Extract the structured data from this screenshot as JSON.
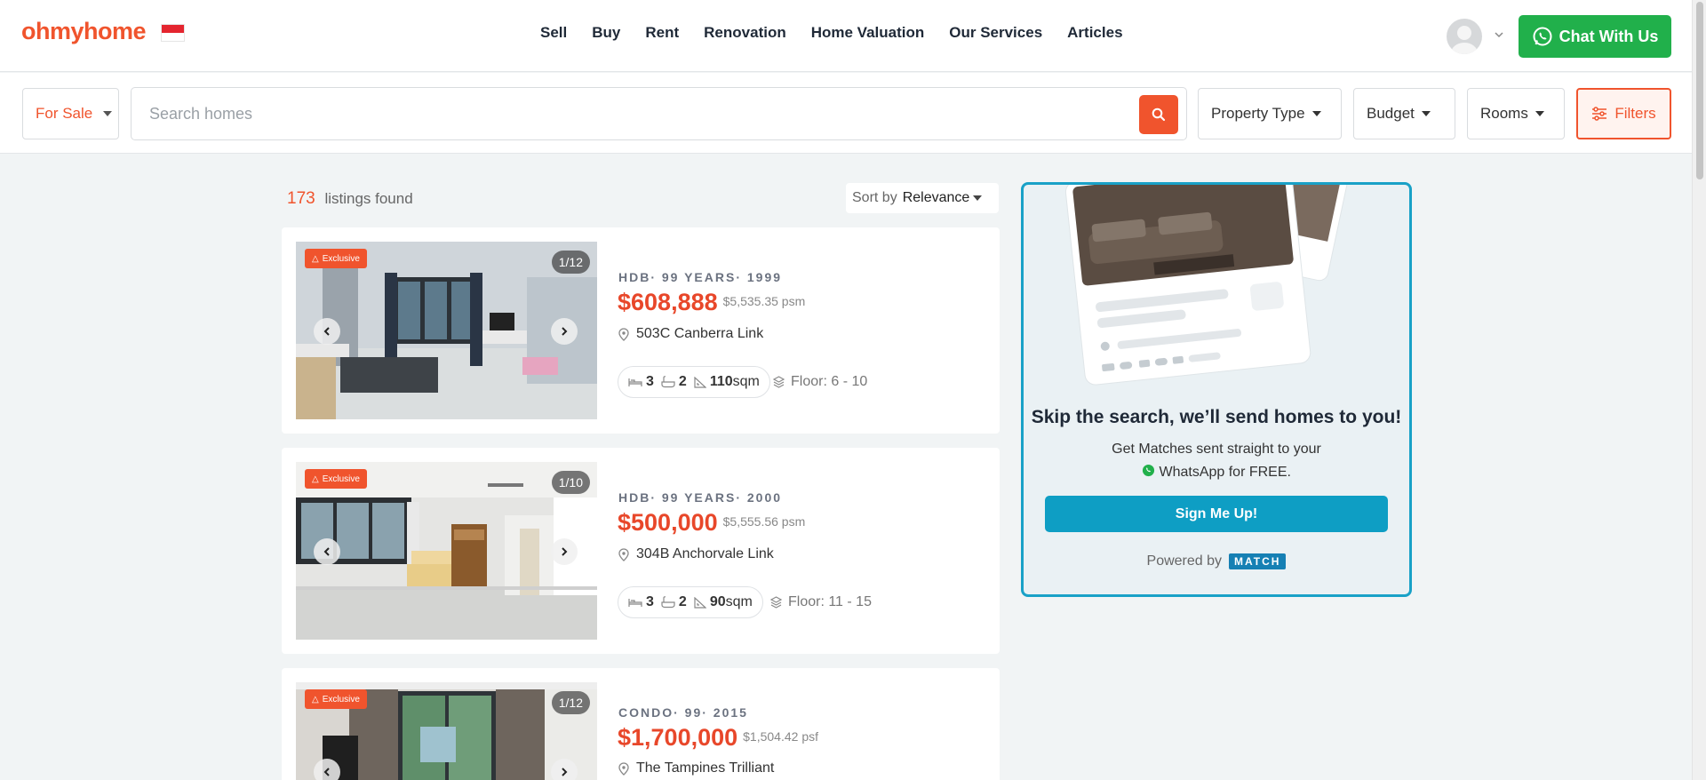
{
  "header": {
    "logo": "ohmyhome",
    "nav": [
      "Sell",
      "Buy",
      "Rent",
      "Renovation",
      "Home Valuation",
      "Our Services",
      "Articles"
    ],
    "chat_label": "Chat With Us"
  },
  "search": {
    "mode": "For Sale",
    "placeholder": "Search homes",
    "property_type": "Property Type",
    "budget": "Budget",
    "rooms": "Rooms",
    "filters": "Filters"
  },
  "results": {
    "count": "173",
    "count_label": "listings found",
    "sort_label": "Sort by",
    "sort_value": "Relevance"
  },
  "listings": [
    {
      "badge": "Exclusive",
      "counter": "1/12",
      "type": "HDB· 99 YEARS· 1999",
      "price": "$608,888",
      "psm": "$5,535.35 psm",
      "address": "503C Canberra Link",
      "beds": "3",
      "baths": "2",
      "area_value": "110",
      "area_unit": "sqm",
      "floor": "Floor: 6 - 10"
    },
    {
      "badge": "Exclusive",
      "counter": "1/10",
      "type": "HDB· 99 YEARS· 2000",
      "price": "$500,000",
      "psm": "$5,555.56 psm",
      "address": "304B Anchorvale Link",
      "beds": "3",
      "baths": "2",
      "area_value": "90",
      "area_unit": "sqm",
      "floor": "Floor: 11 - 15"
    },
    {
      "badge": "Exclusive",
      "counter": "1/12",
      "type": "CONDO· 99· 2015",
      "price": "$1,700,000",
      "psm": "$1,504.42 psf",
      "address": "The Tampines Trilliant"
    }
  ],
  "promo": {
    "title": "Skip the search, we’ll send homes to you!",
    "line1": "Get Matches sent straight to your",
    "line2": "WhatsApp for FREE.",
    "button": "Sign Me Up!",
    "powered_by": "Powered by",
    "partner": "MATCH"
  },
  "colors": {
    "brand": "#f0542d",
    "whatsapp": "#21b04b",
    "promo_border": "#19a1c7"
  }
}
